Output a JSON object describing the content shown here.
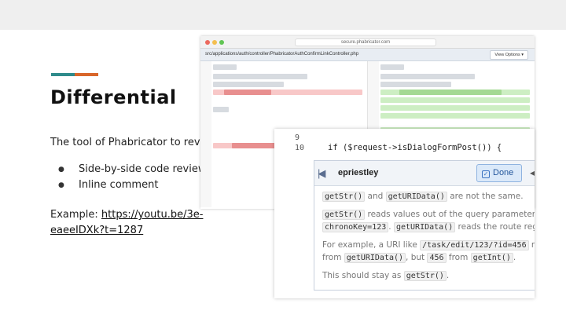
{
  "slide": {
    "title": "Differential",
    "description": "The tool of Phabricator to review code",
    "bullets": [
      "Side-by-side code review",
      "Inline comment"
    ],
    "example_prefix": "Example: ",
    "example_link": "https://youtu.be/3e-eaeeIDXk?t=1287"
  },
  "browser": {
    "url": "secure.phabricator.com",
    "file_path": "src/applications/auth/controller/PhabricatorAuthConfirmLinkController.php",
    "view_options_label": "View Options ▾"
  },
  "zoom": {
    "line_numbers": [
      "9",
      "10"
    ],
    "code": "if ($request->isDialogFormPost()) {",
    "comment": {
      "author": "epriestley",
      "done_label": "Done",
      "collapse_icon": "collapse-icon",
      "para1": {
        "code1": "getStr()",
        "t1": " and ",
        "code2": "getURIData()",
        "t2": " are not the same."
      },
      "para2": {
        "code1": "getStr()",
        "t1": " reads values out of the query parameters, lik",
        "code2": "chronoKey=123",
        "t2": ". ",
        "code3": "getURIData()",
        "t3": " reads the route rege"
      },
      "para3": {
        "t1": "For example, a URI like ",
        "code1": "/task/edit/123/?id=456",
        "t2": " mi",
        "t3": "from ",
        "code2": "getURIData()",
        "t4": ", but ",
        "code3": "456",
        "t5": " from ",
        "code4": "getInt()",
        "t6": "."
      },
      "para4": {
        "t1": "This should stay as ",
        "code1": "getStr()",
        "t2": "."
      }
    }
  },
  "colors": {
    "accent_teal": "#2e8b8b",
    "accent_orange": "#d9662a",
    "removed": "#f8c8c8",
    "added": "#cdeec3"
  }
}
